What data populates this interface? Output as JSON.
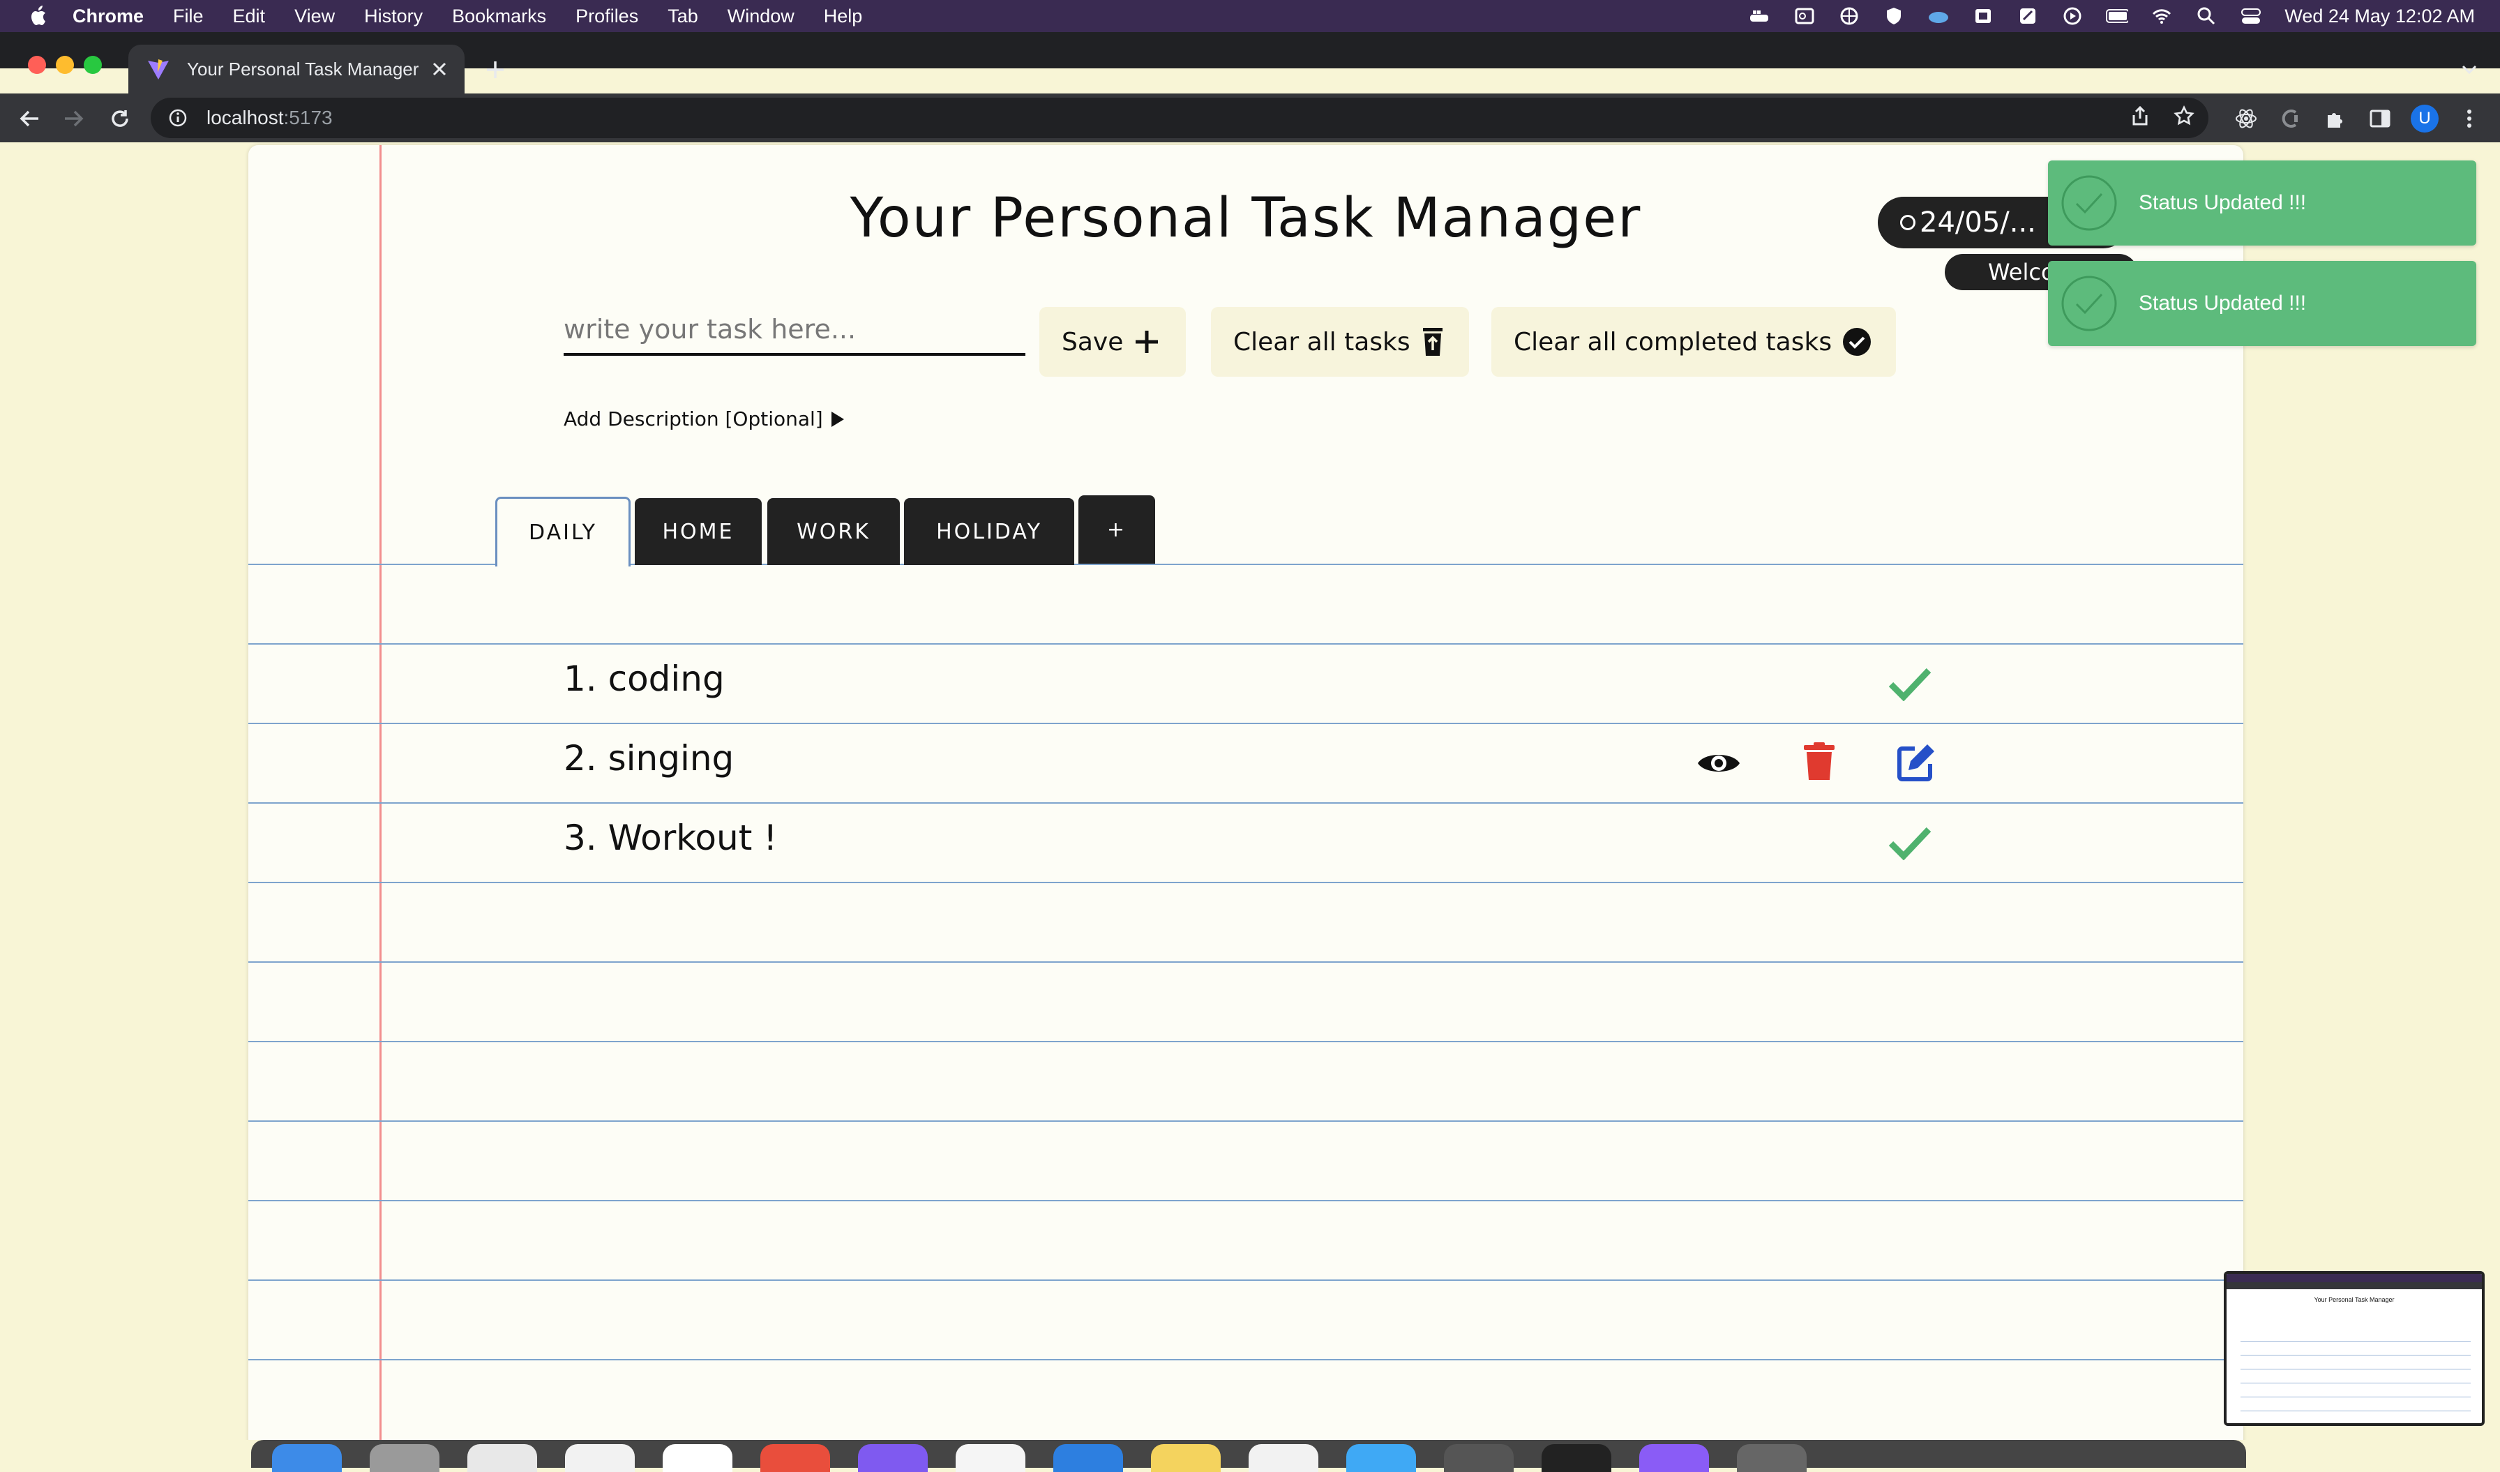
{
  "menubar": {
    "app": "Chrome",
    "items": [
      "File",
      "Edit",
      "View",
      "History",
      "Bookmarks",
      "Profiles",
      "Tab",
      "Window",
      "Help"
    ],
    "clock": "Wed 24 May  12:02 AM"
  },
  "browser": {
    "tab_title": "Your Personal Task Manager",
    "url_host": "localhost",
    "url_port": ":5173",
    "profile_initial": "U"
  },
  "app": {
    "title": "Your Personal Task Manager",
    "date": "24/05/...",
    "welcome": "Welco...",
    "input_placeholder": "write your task here...",
    "save_label": "Save",
    "clear_all_label": "Clear all tasks",
    "clear_completed_label": "Clear all completed tasks",
    "add_description_label": "Add Description [Optional]",
    "tabs": [
      {
        "label": "DAILY",
        "active": true
      },
      {
        "label": "HOME",
        "active": false
      },
      {
        "label": "WORK",
        "active": false
      },
      {
        "label": "HOLIDAY",
        "active": false
      },
      {
        "label": "+",
        "active": false
      }
    ],
    "tasks": [
      {
        "text": "1. coding",
        "completed": true
      },
      {
        "text": "2. singing",
        "completed": false
      },
      {
        "text": "3. Workout !",
        "completed": true
      }
    ]
  },
  "toasts": [
    {
      "message": "Status Updated !!!"
    },
    {
      "message": "Status Updated !!!"
    }
  ],
  "colors": {
    "toast_green": "#5dbb7c",
    "check_green": "#4fb26e",
    "delete_red": "#e03a2f",
    "edit_blue": "#2550c8",
    "margin_red": "#f28e8e",
    "rule_blue": "#7ea4cd"
  }
}
